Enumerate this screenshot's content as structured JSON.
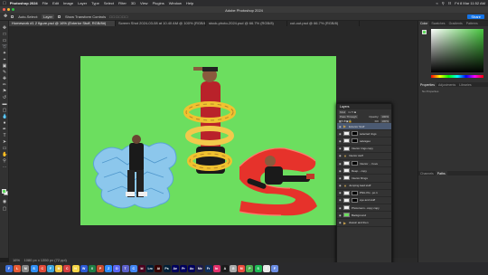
{
  "menubar": {
    "app_name": "Photoshop 2024",
    "items": [
      "File",
      "Edit",
      "Image",
      "Layer",
      "Type",
      "Select",
      "Filter",
      "3D",
      "View",
      "Plugins",
      "Window",
      "Help"
    ],
    "clock": "Fri 8 Mar 11:52 AM"
  },
  "window": {
    "title": "Adobe Photoshop 2024"
  },
  "options_bar": {
    "auto_select_label": "Auto-Select:",
    "auto_select_value": "Layer",
    "show_transform_label": "Show Transform Controls",
    "share_label": "Share"
  },
  "tabs": [
    {
      "label": "Homework #1 2 figure.psd @ 16% (Exterior Stuff, RGB/8#)",
      "active": true
    },
    {
      "label": "Screen Shot 2024-03-08 at 10.40 AM @ 100% (RGB/8#)",
      "active": false
    },
    {
      "label": "stock-photo-2024.psd @ 66.7% (RGB/8)",
      "active": false
    },
    {
      "label": "cut-out.psd @ 66.7% (RGB/8)",
      "active": false
    }
  ],
  "status": {
    "zoom": "16%",
    "doc_info": "1080 px x 1350 px (72 ppi)"
  },
  "color_panel": {
    "tabs": [
      "Color",
      "Swatches",
      "Gradients",
      "Patterns"
    ],
    "foreground": "#5ed85b"
  },
  "properties_panel": {
    "tabs": [
      "Properties",
      "Adjustments",
      "Libraries"
    ],
    "note": "No Properties"
  },
  "bottom_panel": {
    "tabs": [
      "Channels",
      "Paths"
    ]
  },
  "layers_panel": {
    "title": "Layers",
    "kind_label": "Kind",
    "blend_mode": "Pass Through",
    "opacity_label": "Opacity:",
    "opacity_value": "100%",
    "fill_label": "Fill:",
    "fill_value": "100%",
    "rows": [
      {
        "name": "Exterior Stuff",
        "type": "group",
        "selected": true
      },
      {
        "name": "selected rings",
        "type": "layer",
        "thumb": "white"
      },
      {
        "name": "salvageo",
        "type": "layer",
        "thumb": "mask"
      },
      {
        "name": "Interior rings copy",
        "type": "layer",
        "thumb": "white"
      },
      {
        "name": "Interior stuff",
        "type": "group",
        "selected": false
      },
      {
        "name": "Interior ... hove",
        "type": "layer",
        "thumb": "mask"
      },
      {
        "name": "Deep... copy",
        "type": "layer",
        "thumb": "white"
      },
      {
        "name": "Interior Rings",
        "type": "layer",
        "thumb": "white"
      },
      {
        "name": "Jumping lead stuff",
        "type": "group",
        "selected": false
      },
      {
        "name": "PNG Pic...po 1",
        "type": "layer",
        "thumb": "mask"
      },
      {
        "name": "eye and stuff",
        "type": "layer",
        "thumb": "white"
      },
      {
        "name": "Photoroom...copy copy",
        "type": "layer",
        "thumb": "white"
      },
      {
        "name": "Background",
        "type": "layer",
        "thumb": "green"
      },
      {
        "name": "classic and then",
        "type": "layer",
        "thumb": "white"
      }
    ]
  },
  "dock": [
    {
      "label": "F",
      "color": "#3b6fd8"
    },
    {
      "label": "L",
      "color": "#e75b36"
    },
    {
      "label": "M",
      "color": "#888888"
    },
    {
      "label": "S",
      "color": "#2f8ef4"
    },
    {
      "label": "C",
      "color": "#e04a3a"
    },
    {
      "label": "F",
      "color": "#3fa7e0"
    },
    {
      "label": "M",
      "color": "#f2c43d"
    },
    {
      "label": "C",
      "color": "#d63f3f"
    },
    {
      "label": "N",
      "color": "#f5d547"
    },
    {
      "label": "W",
      "color": "#2c5ad5"
    },
    {
      "label": "X",
      "color": "#1e7e45"
    },
    {
      "label": "P",
      "color": "#c64b2d"
    },
    {
      "label": "Z",
      "color": "#2d8cff"
    },
    {
      "label": "D",
      "color": "#5865f2"
    },
    {
      "label": "T",
      "color": "#5b5fc7"
    },
    {
      "label": "C",
      "color": "#4285f4"
    },
    {
      "label": "Id",
      "color": "#49021f"
    },
    {
      "label": "Lrc",
      "color": "#001e36"
    },
    {
      "label": "Ai",
      "color": "#330000"
    },
    {
      "label": "Ps",
      "color": "#001e36"
    },
    {
      "label": "Ae",
      "color": "#00005b"
    },
    {
      "label": "Pr",
      "color": "#00005b"
    },
    {
      "label": "Au",
      "color": "#00005b"
    },
    {
      "label": "Me",
      "color": "#1b1b4b"
    },
    {
      "label": "Fr",
      "color": "#0f2d5c"
    },
    {
      "label": "In",
      "color": "#e1306c"
    },
    {
      "label": "A",
      "color": "#1a1a1a"
    },
    {
      "label": "G",
      "color": "#aaaaaa"
    },
    {
      "label": "M",
      "color": "#e94b3c"
    },
    {
      "label": "P",
      "color": "#4caf50"
    },
    {
      "label": "S",
      "color": "#1db954"
    },
    {
      "label": "T",
      "color": "#e8e8e8"
    },
    {
      "label": "F",
      "color": "#6b8de3"
    }
  ]
}
